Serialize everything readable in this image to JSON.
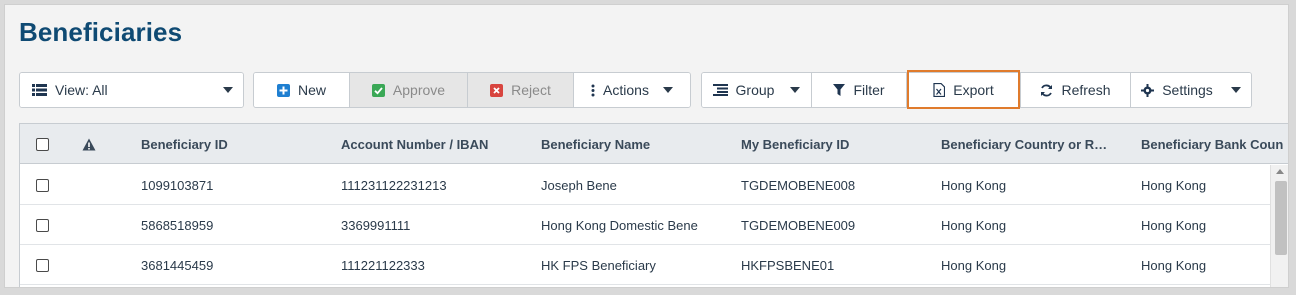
{
  "page": {
    "title": "Beneficiaries"
  },
  "toolbar": {
    "view_label": "View: All",
    "new_label": "New",
    "approve_label": "Approve",
    "reject_label": "Reject",
    "actions_label": "Actions",
    "group_label": "Group",
    "filter_label": "Filter",
    "export_label": "Export",
    "refresh_label": "Refresh",
    "settings_label": "Settings"
  },
  "colors": {
    "title": "#0f4a73",
    "new_icon": "#1f7fd1",
    "approve_icon": "#3aa856",
    "reject_icon": "#d8453f",
    "highlight": "#e07b2c"
  },
  "icons": {
    "view": "list-icon",
    "new": "plus-square-icon",
    "approve": "check-square-icon",
    "reject": "x-square-icon",
    "actions": "vertical-ellipsis-icon",
    "group": "group-list-icon",
    "filter": "funnel-icon",
    "export": "excel-file-icon",
    "refresh": "refresh-icon",
    "settings": "gear-icon",
    "warning": "warning-triangle-icon"
  },
  "table": {
    "columns": [
      "Beneficiary ID",
      "Account Number / IBAN",
      "Beneficiary Name",
      "My Beneficiary ID",
      "Beneficiary Country or R…",
      "Beneficiary Bank Coun"
    ],
    "rows": [
      {
        "id": "1099103871",
        "account": "111231122231213",
        "name": "Joseph Bene",
        "my_id": "TGDEMOBENE008",
        "country": "Hong Kong",
        "bank_country": "Hong Kong"
      },
      {
        "id": "5868518959",
        "account": "3369991111",
        "name": "Hong Kong Domestic Bene",
        "my_id": "TGDEMOBENE009",
        "country": "Hong Kong",
        "bank_country": "Hong Kong"
      },
      {
        "id": "3681445459",
        "account": "111221122333",
        "name": "HK FPS Beneficiary",
        "my_id": "HKFPSBENE01",
        "country": "Hong Kong",
        "bank_country": "Hong Kong"
      }
    ]
  }
}
